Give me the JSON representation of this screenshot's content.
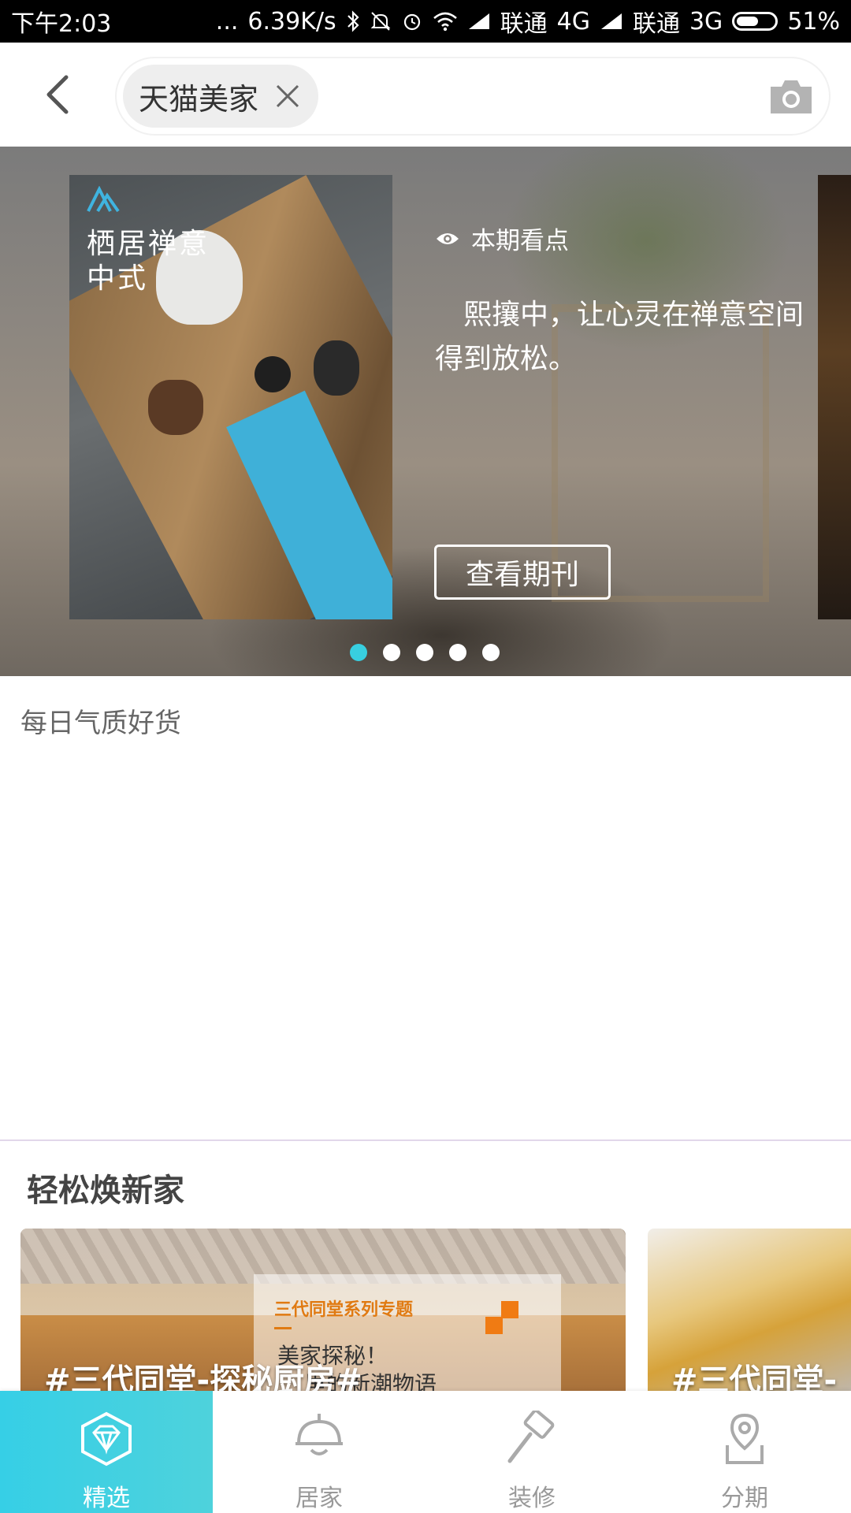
{
  "status_bar": {
    "time": "下午2:03",
    "dots": "...",
    "speed": "6.39K/s",
    "carrier1": "联通",
    "network1": "4G",
    "carrier2": "联通",
    "network2": "3G",
    "battery": "51%"
  },
  "header": {
    "search_tag": "天猫美家",
    "icons": [
      "back-arrow-icon",
      "close-icon",
      "camera-icon"
    ]
  },
  "banner": {
    "cover_title": "栖居禅意\n中式",
    "highlight_label": "本期看点",
    "description": "熙攘中，让心灵在禅意空间得到放松。",
    "button_label": "查看期刊",
    "page_count": 5,
    "active_page": 1,
    "accent_color": "#38cfe0"
  },
  "daily": {
    "title": "每日气质好货"
  },
  "renew": {
    "title": "轻松焕新家",
    "cards": [
      {
        "hashtag": "#三代同堂-探秘厨房#",
        "series_label": "三代同堂系列专题",
        "line1": "美家探秘！",
        "line2": "里的新潮物语"
      },
      {
        "hashtag": "#三代同堂-"
      }
    ]
  },
  "bottom_nav": {
    "active_color": "#36cfe6",
    "items": [
      {
        "label": "精选",
        "icon": "diamond-icon",
        "active": true
      },
      {
        "label": "居家",
        "icon": "ceiling-lamp-icon",
        "active": false
      },
      {
        "label": "装修",
        "icon": "paint-roller-icon",
        "active": false
      },
      {
        "label": "分期",
        "icon": "location-pin-icon",
        "active": false
      }
    ]
  }
}
